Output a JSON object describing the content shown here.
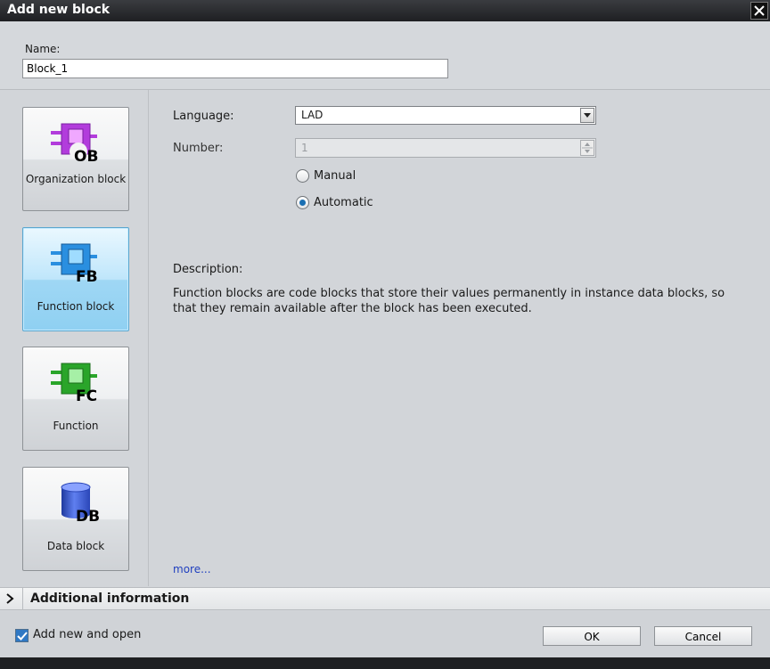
{
  "window": {
    "title": "Add new block"
  },
  "name_field": {
    "label": "Name:",
    "value": "Block_1"
  },
  "blocks": [
    {
      "label": "Organization block",
      "badge": "OB",
      "color": "#b23cdc"
    },
    {
      "label": "Function block",
      "badge": "FB",
      "color": "#2a8fe0",
      "selected": true
    },
    {
      "label": "Function",
      "badge": "FC",
      "color": "#2aa52a"
    },
    {
      "label": "Data block",
      "badge": "DB",
      "color": "#3a55c8"
    }
  ],
  "settings": {
    "language_label": "Language:",
    "language_value": "LAD",
    "number_label": "Number:",
    "number_value": "1",
    "radio_manual": "Manual",
    "radio_automatic": "Automatic",
    "selected_mode": "Automatic"
  },
  "description": {
    "label": "Description:",
    "text": "Function blocks are code blocks that store their values permanently in instance data blocks, so that they remain available after the block has been executed."
  },
  "more_link": "more...",
  "additional_info": {
    "label": "Additional information"
  },
  "footer": {
    "checkbox_label": "Add new and open",
    "checkbox_checked": true,
    "ok_label": "OK",
    "cancel_label": "Cancel"
  }
}
